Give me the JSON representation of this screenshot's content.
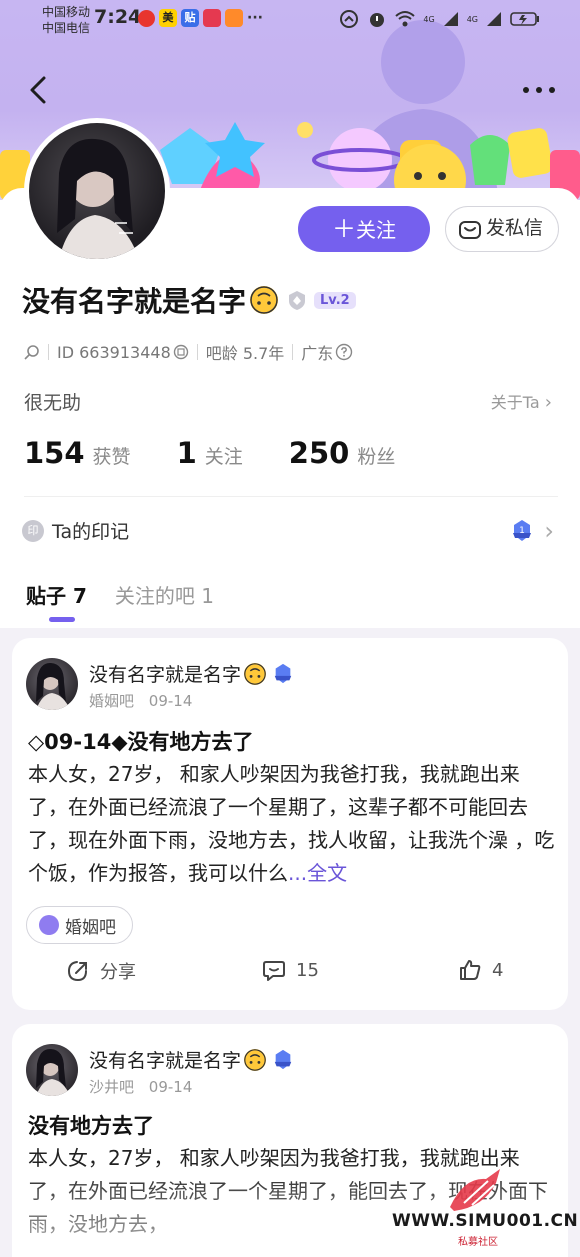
{
  "status_bar": {
    "carrier_1": "中国移动",
    "carrier_2": "中国电信",
    "time": "7:24",
    "app_icons": [
      "weibo-icon",
      "meituan-icon",
      "tieba-icon",
      "book-icon",
      "store-icon"
    ],
    "meituan_label": "美",
    "tieba_label": "贴",
    "more": "···",
    "signal_1": "4G",
    "signal_2": "4G"
  },
  "header": {
    "back": "<",
    "more": "···"
  },
  "profile": {
    "username": "没有名字就是名字",
    "level": "Lv.2",
    "id_text": "ID 663913448",
    "age_text": "吧龄 5.7年",
    "location": "广东",
    "bio": "很无助",
    "about_label": "关于Ta",
    "follow_label": "关注",
    "message_label": "发私信",
    "stats": [
      {
        "num": "154",
        "label": "获赞"
      },
      {
        "num": "1",
        "label": "关注"
      },
      {
        "num": "250",
        "label": "粉丝"
      }
    ],
    "imprint_badge": "印",
    "imprint_label": "Ta的印记"
  },
  "tabs": [
    {
      "label": "贴子 7",
      "active": true
    },
    {
      "label": "关注的吧 1",
      "active": false
    }
  ],
  "posts": [
    {
      "author": "没有名字就是名字",
      "forum": "婚姻吧",
      "date": "09-14",
      "title": "◇09-14◆没有地方去了",
      "body": "本人女，27岁， 和家人吵架因为我爸打我，我就跑出来了，在外面已经流浪了一个星期了，这辈子都不可能回去了，现在外面下雨，没地方去，找人收留，让我洗个澡 ，吃个饭，作为报答，我可以什么",
      "more_link": "...全文",
      "tag": "婚姻吧",
      "share_label": "分享",
      "comments": "15",
      "likes": "4"
    },
    {
      "author": "没有名字就是名字",
      "forum": "沙井吧",
      "date": "09-14",
      "title": "没有地方去了",
      "body": "本人女，27岁， 和家人吵架因为我爸打我，我就跑出来了，在外面已经流浪了一个星期了，能回去了，现在外面下雨，没地方去，"
    }
  ],
  "watermark": {
    "text": "WWW.SIMU001.CN",
    "sub": "私募社区"
  },
  "colors": {
    "accent": "#7560ee",
    "banner": "#c7b6f2",
    "feed_bg": "#f3f1f7"
  }
}
